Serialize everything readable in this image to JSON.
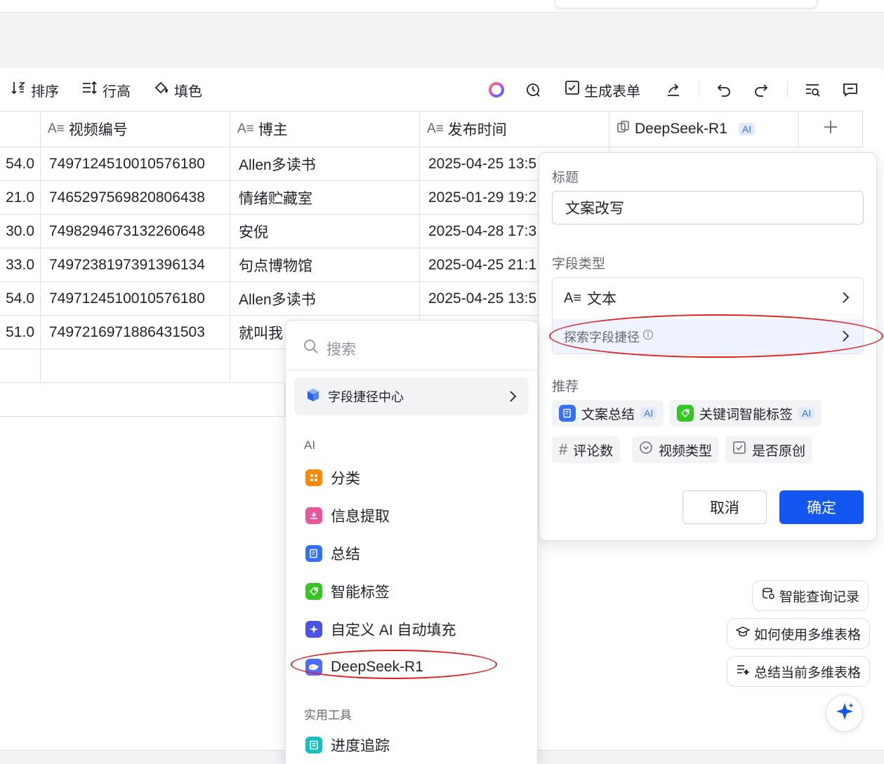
{
  "toolbar": {
    "sort": "排序",
    "row_height": "行高",
    "fill": "填色",
    "generate_form": "生成表单"
  },
  "table": {
    "columns": [
      {
        "label": "视频编号",
        "icon": "text-field-icon"
      },
      {
        "label": "博主",
        "icon": "text-field-icon"
      },
      {
        "label": "发布时间",
        "icon": "text-field-icon"
      },
      {
        "label": "DeepSeek-R1",
        "icon": "ai-field-icon",
        "tag": "AI"
      }
    ],
    "rows": [
      {
        "num": "54.0",
        "video_id": "7497124510010576180",
        "author": "Allen多读书",
        "time": "2025-04-25 13:5"
      },
      {
        "num": "21.0",
        "video_id": "7465297569820806438",
        "author": "情绪贮藏室",
        "time": "2025-01-29 19:2"
      },
      {
        "num": "30.0",
        "video_id": "7498294673132260648",
        "author": "安倪",
        "time": "2025-04-28 17:3"
      },
      {
        "num": "33.0",
        "video_id": "7497238197391396134",
        "author": "句点博物馆",
        "time": "2025-04-25 21:1"
      },
      {
        "num": "54.0",
        "video_id": "7497124510010576180",
        "author": "Allen多读书",
        "time": "2025-04-25 13:5"
      },
      {
        "num": "51.0",
        "video_id": "7497216971886431503",
        "author": "就叫我",
        "time": ""
      }
    ]
  },
  "field_panel": {
    "title_label": "标题",
    "title_value": "文案改写",
    "type_label": "字段类型",
    "type_value": "文本",
    "explore": "探索字段捷径",
    "recommend_label": "推荐",
    "chips": [
      {
        "label": "文案总结",
        "ai": "AI"
      },
      {
        "label": "关键词智能标签",
        "ai": "AI"
      },
      {
        "label": "评论数"
      },
      {
        "label": "视频类型"
      },
      {
        "label": "是否原创"
      }
    ],
    "cancel": "取消",
    "confirm": "确定"
  },
  "menu": {
    "search_placeholder": "搜索",
    "center": "字段捷径中心",
    "ai_section": "AI",
    "ai_items": [
      "分类",
      "信息提取",
      "总结",
      "智能标签",
      "自定义 AI 自动填充",
      "DeepSeek-R1"
    ],
    "tools_section": "实用工具",
    "tool_items": [
      "进度追踪"
    ]
  },
  "helpers": {
    "query_log": "智能查询记录",
    "how_to": "如何使用多维表格",
    "summarize": "总结当前多维表格"
  },
  "colors": {
    "primary": "#1456f0",
    "annotation": "#e02020"
  }
}
